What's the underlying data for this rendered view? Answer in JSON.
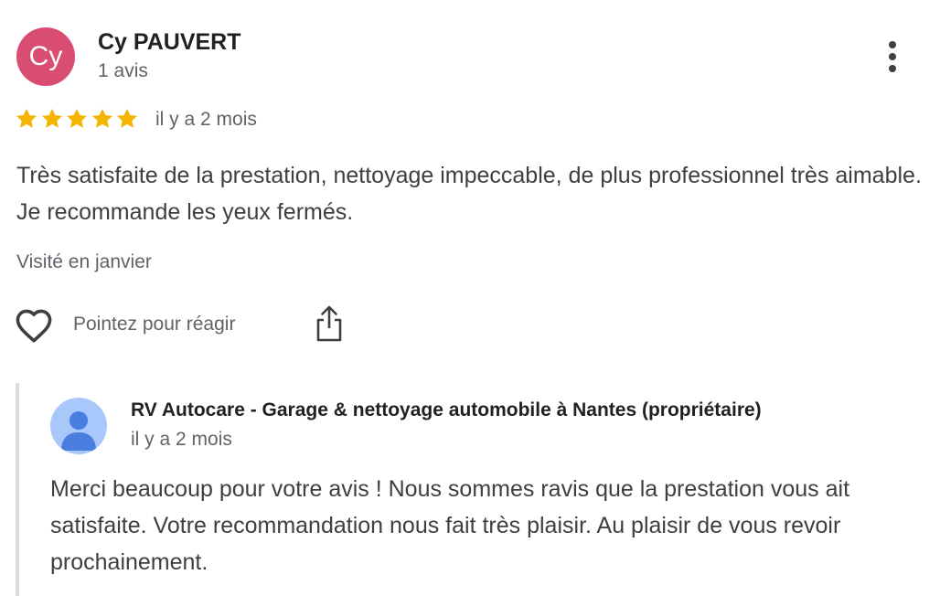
{
  "review": {
    "author": {
      "initials": "Cy",
      "name": "Cy PAUVERT",
      "review_count": "1 avis",
      "avatar_color": "#d94d73"
    },
    "menu_icon": "more-vert-icon",
    "rating": 5,
    "rating_max": 5,
    "star_color": "#f4b400",
    "date": "il y a 2 mois",
    "text": "Très satisfaite de la prestation, nettoyage impeccable, de plus professionnel très aimable. Je recommande les yeux fermés.",
    "visited": "Visité en janvier",
    "actions": {
      "react_icon": "heart-outline-icon",
      "react_label": "Pointez pour réagir",
      "share_icon": "share-icon"
    }
  },
  "owner_reply": {
    "name": "RV Autocare - Garage & nettoyage automobile à Nantes (propriétaire)",
    "date": "il y a 2 mois",
    "avatar_icon": "default-person-avatar-icon",
    "avatar_color": "#a8c7fa",
    "text": "Merci beaucoup pour votre avis ! Nous sommes ravis que la prestation vous ait satisfaite. Votre recommandation nous fait très plaisir. Au plaisir de vous revoir prochainement."
  }
}
